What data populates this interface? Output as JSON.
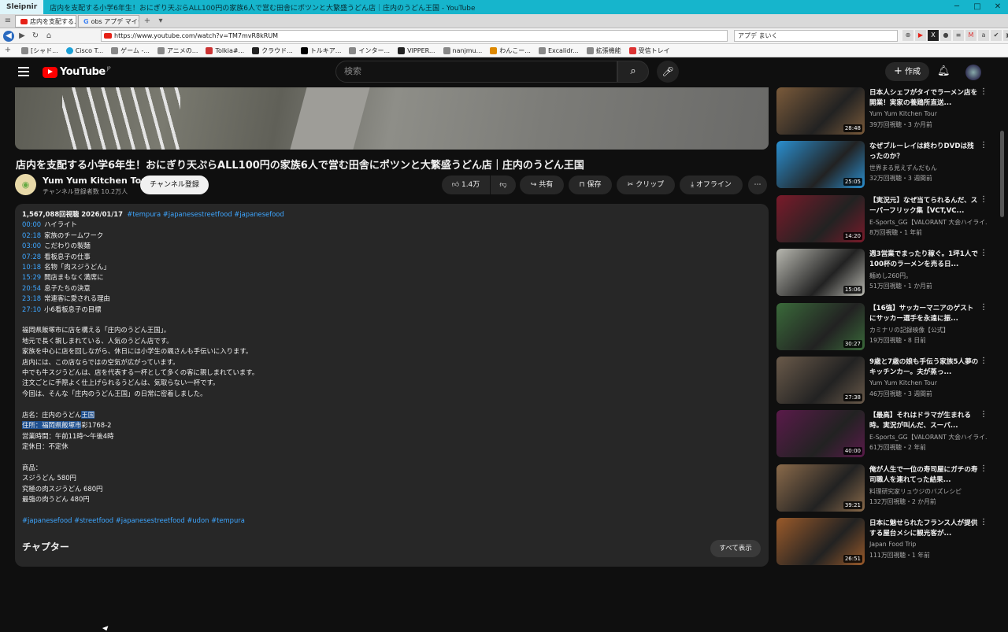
{
  "browser": {
    "app_name": "Sleipnir",
    "window_title": "店内を支配する小学6年生！おにぎり天ぷらALL100円の家族6人で営む田舎にポツンと大繁盛うどん店｜庄内のうどん王国 - YouTube",
    "tabs": [
      {
        "label": "店内を支配する..."
      },
      {
        "label": "obs アプデ マイク..."
      }
    ],
    "url": "https://www.youtube.com/watch?v=TM7mvR8kRUM",
    "search_value": "アプデ まいく",
    "bookmarks": [
      "[シャド...",
      "Cisco T...",
      "ゲーム -...",
      "アニメの...",
      "Tolkia#...",
      "クラウド...",
      "トルキア...",
      "インター...",
      "VIPPER...",
      "nanjmu...",
      "わんこー...",
      "Excalidr...",
      "拡張機能",
      "受信トレイ"
    ]
  },
  "youtube": {
    "logo_text": "YouTube",
    "logo_region": "JP",
    "search_placeholder": "検索",
    "create_label": "作成"
  },
  "video": {
    "title": "店内を支配する小学6年生！おにぎり天ぷらALL100円の家族6人で営む田舎にポツンと大繁盛うどん店｜庄内のうどん王国",
    "channel_name": "Yum Yum Kitchen Tour",
    "subscribers": "チャンネル登録者数 10.2万人",
    "subscribe_label": "チャンネル登録",
    "likes": "1.4万",
    "share_label": "共有",
    "save_label": "保存",
    "clip_label": "クリップ",
    "offline_label": "オフライン"
  },
  "description": {
    "views_date": "1,567,088回視聴  2026/01/17",
    "tags_top": "#tempura #japanesestreetfood #japanesefood",
    "chapters": [
      {
        "time": "00:00",
        "label": "ハイライト"
      },
      {
        "time": "02:18",
        "label": "家族のチームワーク"
      },
      {
        "time": "03:00",
        "label": "こだわりの製麺"
      },
      {
        "time": "07:28",
        "label": "看板息子の仕事"
      },
      {
        "time": "10:18",
        "label": "名物「肉スジうどん」"
      },
      {
        "time": "15:29",
        "label": "開店まもなく満席に"
      },
      {
        "time": "20:54",
        "label": "息子たちの決意"
      },
      {
        "time": "23:18",
        "label": "常連客に愛される理由"
      },
      {
        "time": "27:10",
        "label": "小6看板息子の目標"
      }
    ],
    "paragraph": [
      "福岡県飯塚市に店を構える「庄内のうどん王国」。",
      "地元で長く親しまれている、人気のうどん店です。",
      "家族を中心に店を回しながら、休日には小学生の颯さんも手伝いに入ります。",
      "店内には、この店ならではの空気が広がっています。",
      "中でも牛スジうどんは、店を代表する一杯として多くの客に親しまれています。",
      "注文ごとに手際よく仕上げられるうどんは、気取らない一杯です。",
      "今回は、そんな「庄内のうどん王国」の日常に密着しました。"
    ],
    "shop_name_prefix": "店名：庄内のうどん",
    "shop_name_highlight": "王国",
    "address": "住所：福岡県飯塚市",
    "address_rest": "彩1768-2",
    "hours": "営業時間：午前11時〜午後4時",
    "closed": "定休日：不定休",
    "menu_heading": "商品：",
    "menu": [
      "スジうどん 580円",
      "究極の肉スジうどん 680円",
      "最強の肉うどん 480円"
    ],
    "tags_bottom": "#japanesefood #streetfood #japanesestreetfood #udon #tempura",
    "chapter_heading": "チャプター",
    "show_all_label": "すべて表示"
  },
  "recommendations": [
    {
      "title": "日本人シェフがタイでラーメン店を開業！実家の養鶏所直送...",
      "channel": "Yum Yum Kitchen Tour",
      "meta": "39万回視聴・3 か月前",
      "duration": "28:48",
      "color": "#7a5a3a"
    },
    {
      "title": "なぜブルーレイは終わりDVDは残ったのか？",
      "channel": "世界まる見えずんだもん",
      "meta": "32万回視聴・3 週間前",
      "duration": "25:05",
      "color": "#2a8fd0"
    },
    {
      "title": "【実況元】なぜ当てられるんだ、スーパーフリック集【VCT,VC...",
      "channel": "E-Sports_GG【VALORANT 大会ハイライ...",
      "meta": "8万回視聴・1 年前",
      "duration": "14:20",
      "color": "#7a1a2a"
    },
    {
      "title": "週3営業でまったり稼ぐ。1坪1人で100杯のラーメンを売る日...",
      "channel": "麺めし260円。",
      "meta": "51万回視聴・1 か月前",
      "duration": "15:06",
      "color": "#b8b8b0"
    },
    {
      "title": "【16強】サッカーマニアのゲストにサッカー選手を永遠に振...",
      "channel": "カミナリの記録映像【公式】",
      "meta": "19万回視聴・8 日前",
      "duration": "30:27",
      "color": "#3a6a3a"
    },
    {
      "title": "9歳と7歳の娘も手伝う家族5人夢のキッチンカー。夫が蒸っ...",
      "channel": "Yum Yum Kitchen Tour",
      "meta": "46万回視聴・3 週間前",
      "duration": "27:38",
      "color": "#6a5a4a"
    },
    {
      "title": "【最高】それはドラマが生まれる時。実況が叫んだ、スーパ...",
      "channel": "E-Sports_GG【VALORANT 大会ハイライ...",
      "meta": "61万回視聴・2 年前",
      "duration": "40:00",
      "color": "#5a1a4a"
    },
    {
      "title": "俺が人生で一位の寿司屋にガチの寿司職人を連れてった結果...",
      "channel": "料理研究家リュウジのバズレシピ",
      "meta": "132万回視聴・2 か月前",
      "duration": "39:21",
      "color": "#8a6a4a"
    },
    {
      "title": "日本に魅せられたフランス人が提供する屋台メシに観光客が...",
      "channel": "Japan Food Trip",
      "meta": "111万回視聴・1 年前",
      "duration": "26:51",
      "color": "#9a5a2a"
    }
  ]
}
